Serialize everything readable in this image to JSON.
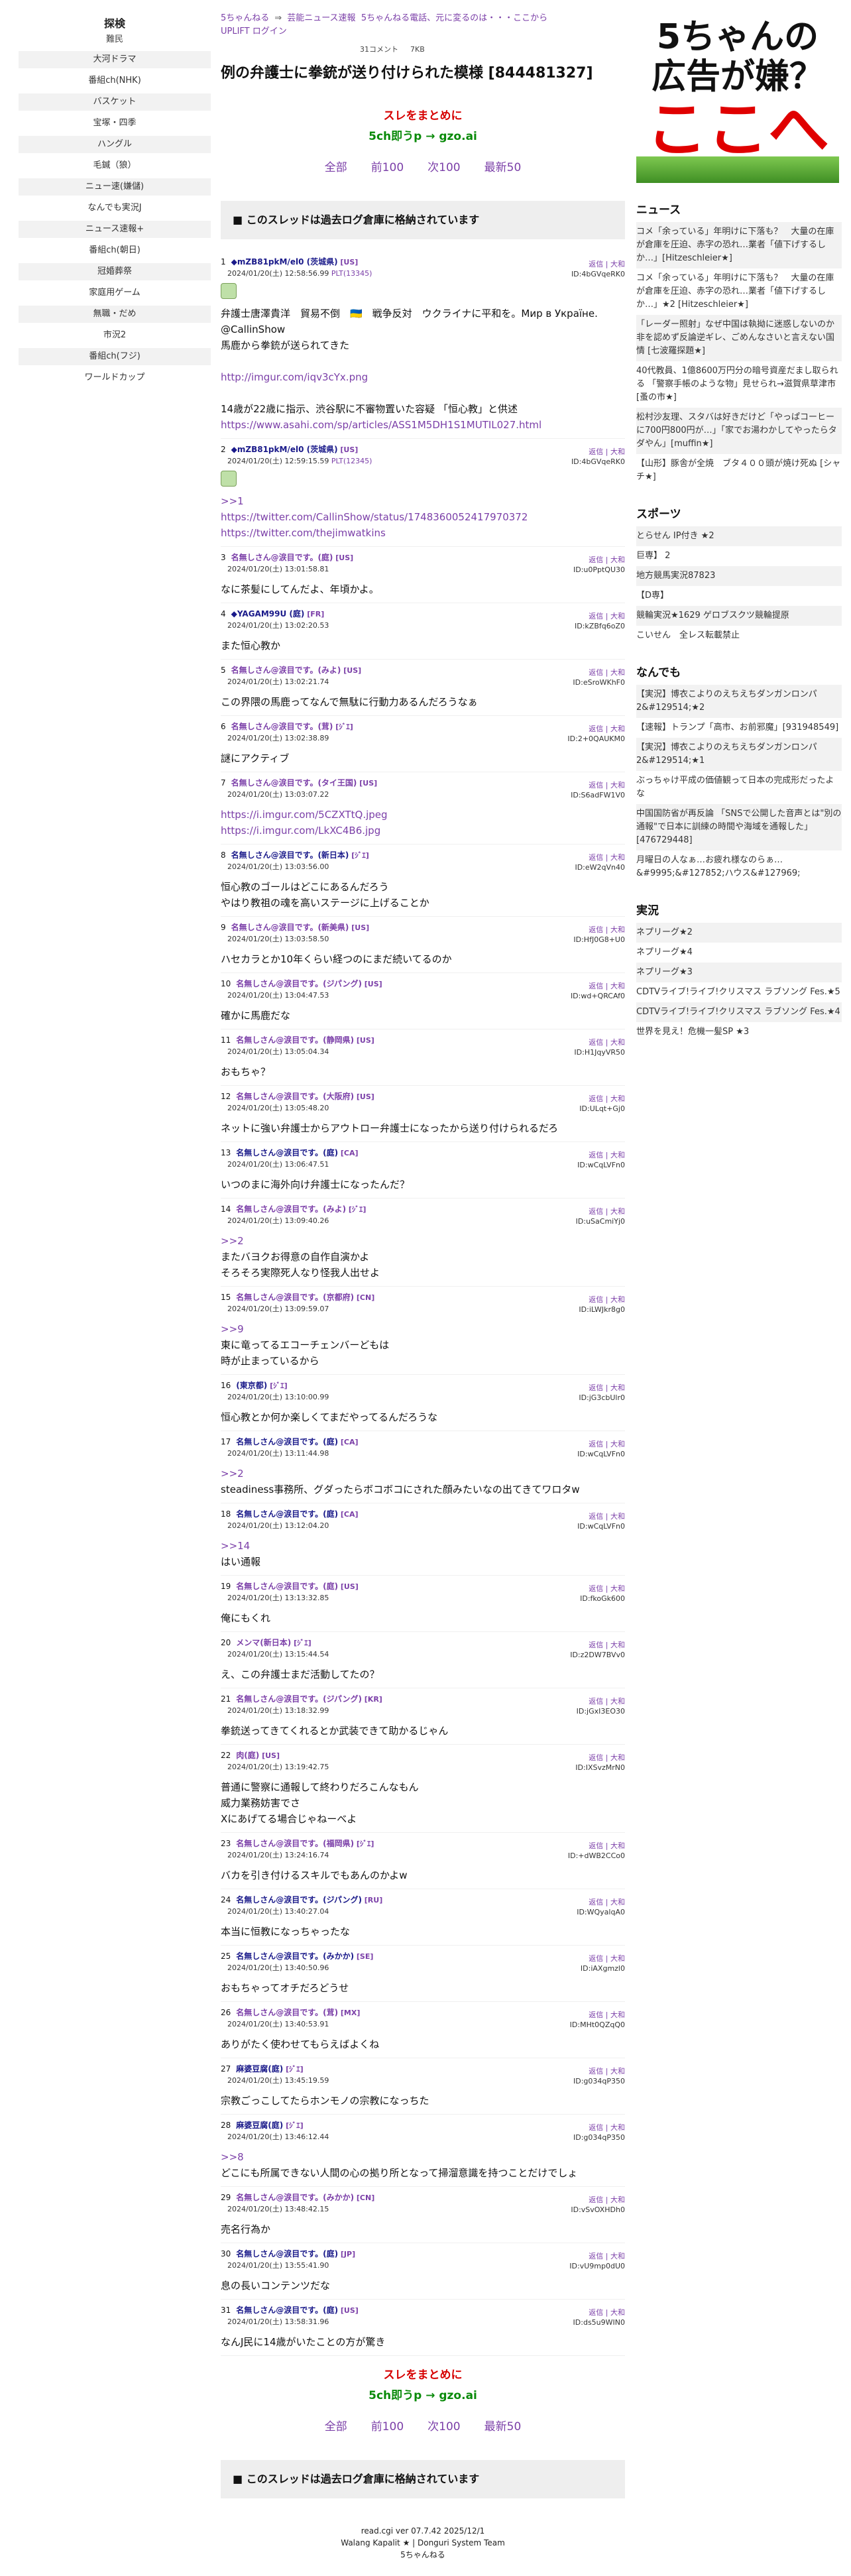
{
  "sidebar": {
    "title": "探検",
    "sub": "難民",
    "items": [
      "大河ドラマ",
      "番組ch(NHK)",
      "バスケット",
      "宝塚・四季",
      "ハングル",
      "毛鍼（狼）",
      "ニュー速(嫌儲)",
      "なんでも実況J",
      "ニュース速報+",
      "番組ch(朝日)",
      "冠婚葬祭",
      "家庭用ゲーム",
      "無職・だめ",
      "市況2",
      "番組ch(フジ)",
      "ワールドカップ"
    ]
  },
  "crumb": {
    "c1": "5ちゃんねる",
    "arrow": "⇒",
    "c2": "芸能ニュース速報",
    "c3": "5ちゃんねる電話、元に変るのは・・・ここから",
    "c4": "UPLIFT ログイン"
  },
  "meta": {
    "comments": "31コメント",
    "size": "7KB"
  },
  "thread_title": "例の弁護士に拳銃が送り付けられた模様 [844481327]",
  "ad": {
    "line1": "スレをまとめに",
    "line2": "5ch即うp → gzo.ai"
  },
  "pager": [
    "全部",
    "前100",
    "次100",
    "最新50"
  ],
  "archived": "■ このスレッドは過去ログ倉庫に格納されています",
  "post_actions": {
    "reply": "返信",
    "sep": "|",
    "big": "大和"
  },
  "posts": [
    {
      "num": "1",
      "name": "◆mZB81pkM/el0 (茨城県)",
      "region": "[US]",
      "date": "2024/01/20(土) 12:58:56.99",
      "link": "PLT(13345)",
      "id": "ID:4bGVqeRK0",
      "avatar": true,
      "name_style": "blue",
      "lines": [
        "弁護士唐澤貴洋　貿易不倒　🇺🇦　戦争反対　ウクライナに平和を。Мир в Україне.",
        "@CallinShow",
        "馬鹿から拳銃が送られてきた",
        "",
        "http://imgur.com/iqv3cYx.png",
        "",
        "14歳が22歳に指示、渋谷駅に不審物置いた容疑 「恒心教」と供述",
        "https://www.asahi.com/sp/articles/ASS1M5DH1S1MUTIL027.html"
      ],
      "link_lines": [
        4,
        7
      ]
    },
    {
      "num": "2",
      "name": "◆mZB81pkM/el0 (茨城県)",
      "region": "[US]",
      "date": "2024/01/20(土) 12:59:15.59",
      "link": "PLT(12345)",
      "id": "ID:4bGVqeRK0",
      "avatar": true,
      "name_style": "blue",
      "lines": [
        ">>1",
        "https://twitter.com/CallinShow/status/1748360052417970372",
        "https://twitter.com/thejimwatkins"
      ],
      "link_lines": [
        0,
        1,
        2
      ]
    },
    {
      "num": "3",
      "name": "名無しさん@涙目です。(庭)",
      "region": "[US]",
      "date": "2024/01/20(土) 13:01:58.81",
      "id": "ID:u0PptQU30",
      "lines": [
        "なに茶髪にしてんだよ、年頃かよ。"
      ],
      "name_style": "purple"
    },
    {
      "num": "4",
      "name": "◆YAGAM99U (庭)",
      "region": "[FR]",
      "date": "2024/01/20(土) 13:02:20.53",
      "id": "ID:kZBfq6oZ0",
      "lines": [
        "また恒心教か"
      ],
      "name_style": "blue"
    },
    {
      "num": "5",
      "name": "名無しさん@涙目です。(みよ)",
      "region": "[US]",
      "date": "2024/01/20(土) 13:02:21.74",
      "id": "ID:eSroWKhF0",
      "lines": [
        "この界隈の馬鹿ってなんで無駄に行動力あるんだろうなぁ"
      ],
      "name_style": "purple"
    },
    {
      "num": "6",
      "name": "名無しさん@涙目です。(茸)",
      "region": "[ｼﾞｴ]",
      "date": "2024/01/20(土) 13:02:38.89",
      "id": "ID:2+0QAUKM0",
      "lines": [
        "謎にアクティブ"
      ],
      "name_style": "purple"
    },
    {
      "num": "7",
      "name": "名無しさん@涙目です。(タイ王国)",
      "region": "[US]",
      "date": "2024/01/20(土) 13:03:07.22",
      "id": "ID:S6adFW1V0",
      "lines": [
        "https://i.imgur.com/5CZXTtQ.jpeg",
        "https://i.imgur.com/LkXC4B6.jpg"
      ],
      "link_lines": [
        0,
        1
      ],
      "name_style": "purple"
    },
    {
      "num": "8",
      "name": "名無しさん@涙目です。(新日本)",
      "region": "[ｼﾞｴ]",
      "date": "2024/01/20(土) 13:03:56.00",
      "id": "ID:eW2qVn40",
      "lines": [
        "恒心教のゴールはどこにあるんだろう",
        "やはり教祖の魂を高いステージに上げることか"
      ],
      "name_style": "blue"
    },
    {
      "num": "9",
      "name": "名無しさん@涙目です。(新美県)",
      "region": "[US]",
      "date": "2024/01/20(土) 13:03:58.50",
      "id": "ID:HfJ0G8+U0",
      "lines": [
        "ハセカラとか10年くらい経つのにまだ続いてるのか"
      ],
      "name_style": "purple"
    },
    {
      "num": "10",
      "name": "名無しさん@涙目です。(ジパング)",
      "region": "[US]",
      "date": "2024/01/20(土) 13:04:47.53",
      "id": "ID:wd+QRCAf0",
      "lines": [
        "確かに馬鹿だな"
      ],
      "name_style": "purple"
    },
    {
      "num": "11",
      "name": "名無しさん@涙目です。(静岡県)",
      "region": "[US]",
      "date": "2024/01/20(土) 13:05:04.34",
      "id": "ID:H1JqyVR50",
      "lines": [
        "おもちゃ？"
      ],
      "name_style": "purple"
    },
    {
      "num": "12",
      "name": "名無しさん@涙目です。(大阪府)",
      "region": "[US]",
      "date": "2024/01/20(土) 13:05:48.20",
      "id": "ID:ULqt+Gj0",
      "lines": [
        "ネットに強い弁護士からアウトロー弁護士になったから送り付けられるだろ"
      ],
      "name_style": "purple"
    },
    {
      "num": "13",
      "name": "名無しさん@涙目です。(庭)",
      "region": "[CA]",
      "date": "2024/01/20(土) 13:06:47.51",
      "id": "ID:wCqLVFn0",
      "lines": [
        "いつのまに海外向け弁護士になったんだ？"
      ],
      "name_style": "blue"
    },
    {
      "num": "14",
      "name": "名無しさん@涙目です。(みよ)",
      "region": "[ｼﾞｴ]",
      "date": "2024/01/20(土) 13:09:40.26",
      "id": "ID:uSaCmiYj0",
      "lines": [
        ">>2",
        "またバヨクお得意の自作自演かよ",
        "そろそろ実際死人なり怪我人出せよ"
      ],
      "link_lines": [
        0
      ],
      "name_style": "purple"
    },
    {
      "num": "15",
      "name": "名無しさん@涙目です。(京都府)",
      "region": "[CN]",
      "date": "2024/01/20(土) 13:09:59.07",
      "id": "ID:iLWJkr8g0",
      "lines": [
        ">>9",
        "東に竜ってるエコーチェンバーどもは",
        "時が止まっているから"
      ],
      "link_lines": [
        0
      ],
      "name_style": "purple"
    },
    {
      "num": "16",
      "name": "(東京都)",
      "region": "[ｼﾞｴ]",
      "date": "2024/01/20(土) 13:10:00.99",
      "id": "ID:jG3cbUlr0",
      "lines": [
        "恒心教とか何か楽しくてまだやってるんだろうな"
      ],
      "name_style": "blue"
    },
    {
      "num": "17",
      "name": "名無しさん@涙目です。(庭)",
      "region": "[CA]",
      "date": "2024/01/20(土) 13:11:44.98",
      "id": "ID:wCqLVFn0",
      "lines": [
        ">>2",
        "steadiness事務所、グダったらボコボコにされた顔みたいなの出てきてワロタw"
      ],
      "link_lines": [
        0
      ],
      "name_style": "blue"
    },
    {
      "num": "18",
      "name": "名無しさん@涙目です。(庭)",
      "region": "[CA]",
      "date": "2024/01/20(土) 13:12:04.20",
      "id": "ID:wCqLVFn0",
      "lines": [
        ">>14",
        "はい通報"
      ],
      "link_lines": [
        0
      ],
      "name_style": "blue"
    },
    {
      "num": "19",
      "name": "名無しさん@涙目です。(庭)",
      "region": "[US]",
      "date": "2024/01/20(土) 13:13:32.85",
      "id": "ID:fkoGk600",
      "lines": [
        "俺にもくれ"
      ],
      "name_style": "purple"
    },
    {
      "num": "20",
      "name": "メンマ(新日本)",
      "region": "[ｼﾞｴ]",
      "date": "2024/01/20(土) 13:15:44.54",
      "id": "ID:z2DW7BVv0",
      "lines": [
        "え、この弁護士まだ活動してたの？"
      ],
      "name_style": "purple"
    },
    {
      "num": "21",
      "name": "名無しさん@涙目です。(ジパング)",
      "region": "[KR]",
      "date": "2024/01/20(土) 13:18:32.99",
      "id": "ID:jGxI3EO30",
      "lines": [
        "拳銃送ってきてくれるとか武装できて助かるじゃん"
      ],
      "name_style": "purple"
    },
    {
      "num": "22",
      "name": "肉(庭)",
      "region": "[US]",
      "date": "2024/01/20(土) 13:19:42.75",
      "id": "ID:IXSvzMrN0",
      "lines": [
        "普通に警察に通報して終わりだろこんなもん",
        "威力業務妨害でさ",
        "Xにあげてる場合じゃねーべよ"
      ],
      "name_style": "purple"
    },
    {
      "num": "23",
      "name": "名無しさん@涙目です。(福岡県)",
      "region": "[ｼﾞｴ]",
      "date": "2024/01/20(土) 13:24:16.74",
      "id": "ID:+dWB2CCo0",
      "lines": [
        "バカを引き付けるスキルでもあんのかよw"
      ],
      "name_style": "purple"
    },
    {
      "num": "24",
      "name": "名無しさん@涙目です。(ジパング)",
      "region": "[RU]",
      "date": "2024/01/20(土) 13:40:27.04",
      "id": "ID:WQyalqA0",
      "lines": [
        "本当に恒教になっちゃったな"
      ],
      "name_style": "blue"
    },
    {
      "num": "25",
      "name": "名無しさん@涙目です。(みかか)",
      "region": "[SE]",
      "date": "2024/01/20(土) 13:40:50.96",
      "id": "ID:iAXgmzl0",
      "lines": [
        "おもちゃってオチだろどうせ"
      ],
      "name_style": "blue"
    },
    {
      "num": "26",
      "name": "名無しさん@涙目です。(茸)",
      "region": "[MX]",
      "date": "2024/01/20(土) 13:40:53.91",
      "id": "ID:MHt0QZqQ0",
      "lines": [
        "ありがたく使わせてもらえばよくね"
      ],
      "name_style": "purple"
    },
    {
      "num": "27",
      "name": "麻婆豆腐(庭)",
      "region": "[ｼﾞｴ]",
      "date": "2024/01/20(土) 13:45:19.59",
      "id": "ID:g034qP350",
      "lines": [
        "宗教ごっこしてたらホンモノの宗教になっちた"
      ],
      "name_style": "blue"
    },
    {
      "num": "28",
      "name": "麻婆豆腐(庭)",
      "region": "[ｼﾞｴ]",
      "date": "2024/01/20(土) 13:46:12.44",
      "id": "ID:g034qP350",
      "lines": [
        ">>8",
        "どこにも所属できない人間の心の拠り所となって掃溜意識を持つことだけでしょ"
      ],
      "link_lines": [
        0
      ],
      "name_style": "blue"
    },
    {
      "num": "29",
      "name": "名無しさん@涙目です。(みかか)",
      "region": "[CN]",
      "date": "2024/01/20(土) 13:48:42.15",
      "id": "ID:vSvOXHDh0",
      "lines": [
        "売名行為か"
      ],
      "name_style": "purple"
    },
    {
      "num": "30",
      "name": "名無しさん@涙目です。(庭)",
      "region": "[JP]",
      "date": "2024/01/20(土) 13:55:41.90",
      "id": "ID:vU9mp0dU0",
      "lines": [
        "息の長いコンテンツだな"
      ],
      "name_style": "blue"
    },
    {
      "num": "31",
      "name": "名無しさん@涙目です。(庭)",
      "region": "[US]",
      "date": "2024/01/20(土) 13:58:31.96",
      "id": "ID:ds5u9WIN0",
      "lines": [
        "なんJ民に14歳がいたことの方が驚き"
      ],
      "name_style": "blue"
    }
  ],
  "footer": [
    "read.cgi ver 07.7.42 2025/12/1",
    "Walang Kapalit ★ | Donguri System Team",
    "5ちゃんねる"
  ],
  "right": {
    "banner_line1": "5ちゃんの",
    "banner_line2": "広告が嫌？",
    "banner_line3": "ここへ",
    "sections": [
      {
        "title": "ニュース",
        "items": [
          "コメ「余っている」年明けに下落も？　大量の在庫が倉庫を圧迫、赤字の恐れ…業者「値下げするしか…」[Hitzeschleier★]",
          "コメ「余っている」年明けに下落も？　大量の在庫が倉庫を圧迫、赤字の恐れ…業者「値下げするしか…」★2 [Hitzeschleier★]",
          "「レーダー照射」なぜ中国は執拗に迷惑しないのか 非を認めず反論逆ギレ、ごめんなさいと言えない国情 [七波羅探題★]",
          "40代教員、1億8600万円分の暗号資産だまし取られる 「警察手帳のような物」見せられ→滋賀県草津市 [蚤の市★]",
          "松村沙友理、スタバは好きだけど「やっぱコーヒーに700円800円が…」「家でお湯わかしてやったらタダやん」[muffin★]",
          "【山形】豚舎が全焼　ブタ４００頭が焼け死ぬ [シャチ★]"
        ]
      },
      {
        "title": "スポーツ",
        "items": [
          "とらせん IP付き ★2",
          "巨専】 2",
          "地方競馬実況87823",
          "【D専】",
          "競輪実況★1629 ゲロブスクツ競輪提原",
          "こいせん　全レス転載禁止"
        ]
      },
      {
        "title": "なんでも",
        "items": [
          "【実況】博衣こよりのえちえちダンガンロンパ2&#129514;★2",
          "【速報】トランプ「高市、お前邪魔」[931948549]",
          "【実況】博衣こよりのえちえちダンガンロンパ2&#129514;★1",
          "ぶっちゃけ平成の価値観って日本の完成形だったよな",
          "中国国防省が再反論 「SNSで公開した音声とは\"別の通報\"で日本に訓練の時間や海域を通報した」[476729448]",
          "月曜日の人なぁ…お疲れ様なのらぁ…&#9995;&#127852;ハウス&#127969;"
        ]
      },
      {
        "title": "実況",
        "items": [
          "ネプリーグ★2",
          "ネプリーグ★4",
          "ネプリーグ★3",
          "CDTVライブ!ライブ!クリスマス ラブソング Fes.★5",
          "CDTVライブ!ライブ!クリスマス ラブソング Fes.★4",
          "世界を見え！危機一髪SP ★3"
        ]
      }
    ]
  }
}
